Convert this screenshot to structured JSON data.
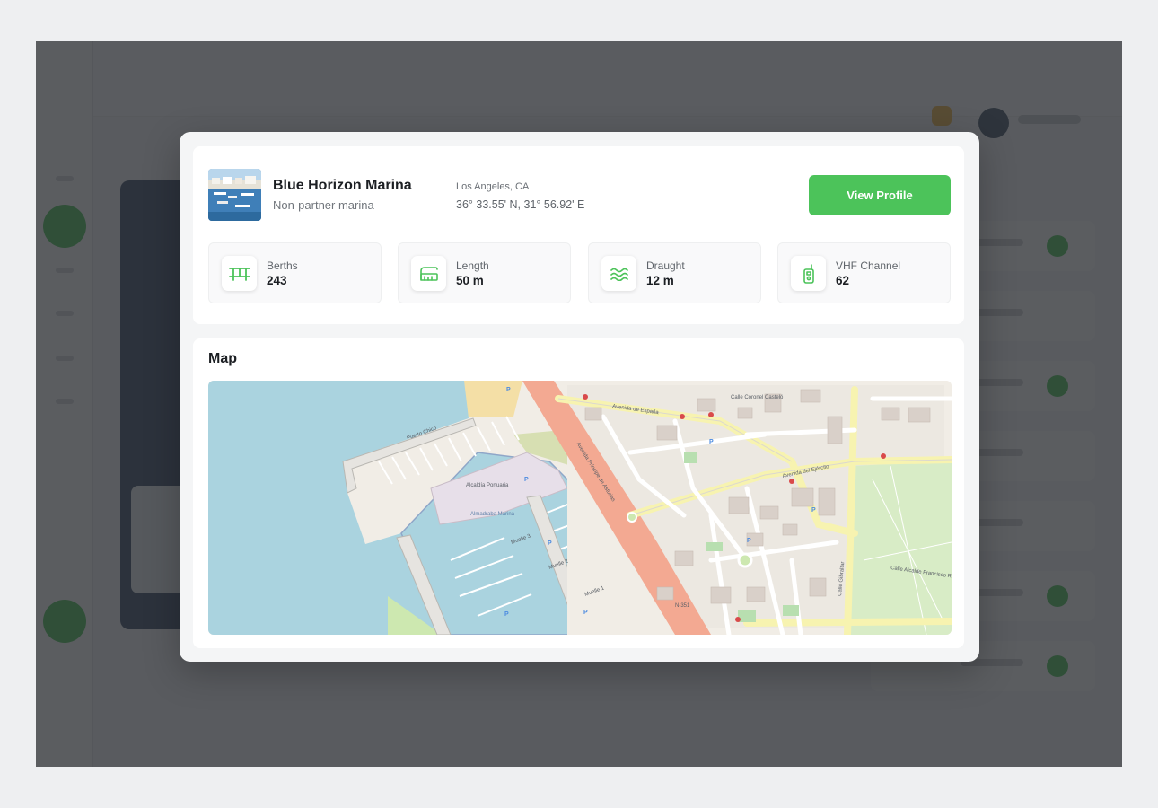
{
  "marina": {
    "name": "Blue Horizon Marina",
    "type": "Non-partner marina",
    "city": "Los Angeles, CA",
    "coordinates": "36° 33.55' N, 31° 56.92' E",
    "thumbnail_icon": "marina-photo"
  },
  "actions": {
    "view_profile_label": "View Profile",
    "accent_color": "#4cc35a"
  },
  "stats": [
    {
      "label": "Berths",
      "value": "243",
      "icon": "pier-icon"
    },
    {
      "label": "Length",
      "value": "50 m",
      "icon": "ruler-icon"
    },
    {
      "label": "Draught",
      "value": "12 m",
      "icon": "waves-icon"
    },
    {
      "label": "VHF Channel",
      "value": "62",
      "icon": "radio-icon"
    }
  ],
  "map": {
    "title": "Map",
    "labels": {
      "dock_label": "Puerto Chico",
      "building": "Alcaldía Portuaria",
      "basin": "Almadraba Marina",
      "pier_1": "Muelle 3",
      "pier_2": "Muelle 2",
      "pier_3": "Muelle 1",
      "avenue_1": "Avenida de España",
      "avenue_2": "Avenida del Ejército",
      "avenue_3": "Avenida Príncipe de Asturias",
      "street_1": "Calle Coronel Casteló",
      "street_2": "Calle Alcalde Francisco Ruiz",
      "street_3": "Calle Gibraltar",
      "road_id": "N-351"
    }
  }
}
